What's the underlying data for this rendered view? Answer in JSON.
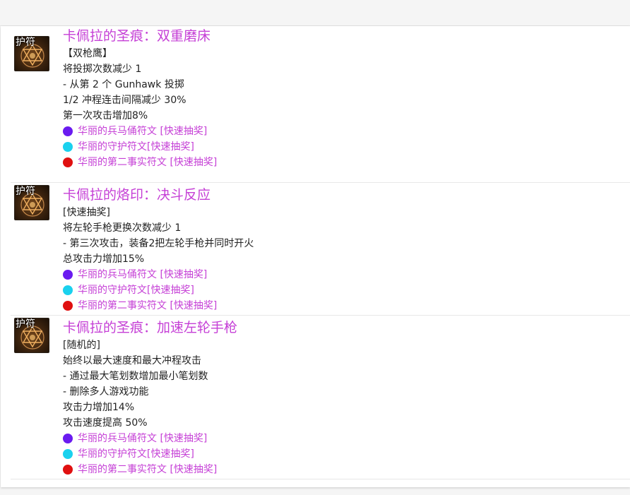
{
  "items": [
    {
      "icon_label": "护符",
      "title": "卡佩拉的圣痕：双重磨床",
      "lines": [
        "【双枪鹰】",
        "将投掷次数减少 1",
        "- 从第 2 个 Gunhawk 投掷",
        "1/2 冲程连击间隔减少 30%",
        "第一次攻击增加8%"
      ],
      "runes": [
        {
          "color": "#6a1bf0",
          "text": "华丽的兵马俑符文 [快速抽奖]"
        },
        {
          "color": "#1ad1ee",
          "text": "华丽的守护符文[快速抽奖]"
        },
        {
          "color": "#e01010",
          "text": "华丽的第二事实符文 [快速抽奖]"
        }
      ]
    },
    {
      "icon_label": "护符",
      "title": "卡佩拉的烙印：决斗反应",
      "lines": [
        "[快速抽奖]",
        "将左轮手枪更换次数减少 1",
        "- 第三次攻击，装备2把左轮手枪并同时开火",
        "总攻击力增加15%"
      ],
      "runes": [
        {
          "color": "#6a1bf0",
          "text": "华丽的兵马俑符文 [快速抽奖]"
        },
        {
          "color": "#1ad1ee",
          "text": "华丽的守护符文[快速抽奖]"
        },
        {
          "color": "#e01010",
          "text": "华丽的第二事实符文 [快速抽奖]"
        }
      ]
    },
    {
      "icon_label": "护符",
      "title": "卡佩拉的圣痕：加速左轮手枪",
      "lines": [
        "[随机的]",
        "始终以最大速度和最大冲程攻击",
        "- 通过最大笔划数增加最小笔划数",
        "- 删除多人游戏功能",
        "攻击力增加14%",
        "攻击速度提高 50%"
      ],
      "runes": [
        {
          "color": "#6a1bf0",
          "text": "华丽的兵马俑符文 [快速抽奖]"
        },
        {
          "color": "#1ad1ee",
          "text": "华丽的守护符文[快速抽奖]"
        },
        {
          "color": "#e01010",
          "text": "华丽的第二事实符文 [快速抽奖]"
        }
      ]
    }
  ]
}
